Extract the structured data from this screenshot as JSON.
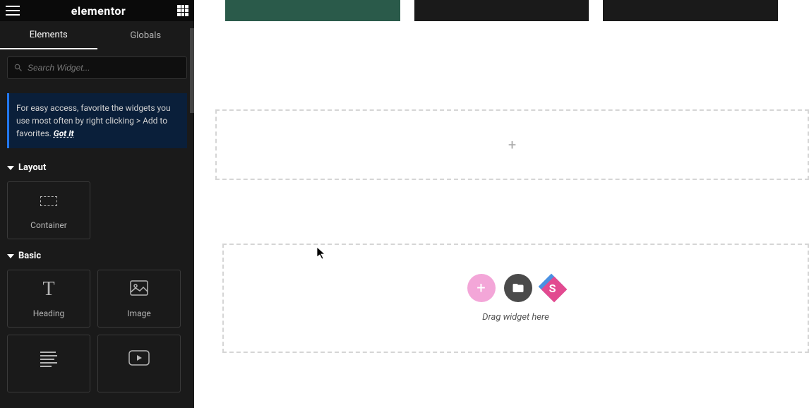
{
  "header": {
    "logo": "elementor"
  },
  "tabs": {
    "elements": "Elements",
    "globals": "Globals"
  },
  "search": {
    "placeholder": "Search Widget..."
  },
  "tip": {
    "text": "For easy access, favorite the widgets you use most often by right clicking > Add to favorites.",
    "got_it": "Got It"
  },
  "categories": {
    "layout": {
      "title": "Layout",
      "widgets": {
        "container": "Container"
      }
    },
    "basic": {
      "title": "Basic",
      "widgets": {
        "heading": "Heading",
        "image": "Image",
        "text_editor": "",
        "video": ""
      }
    }
  },
  "canvas": {
    "drop_hint": "Drag widget here",
    "plus": "+",
    "add_plus": "+"
  }
}
